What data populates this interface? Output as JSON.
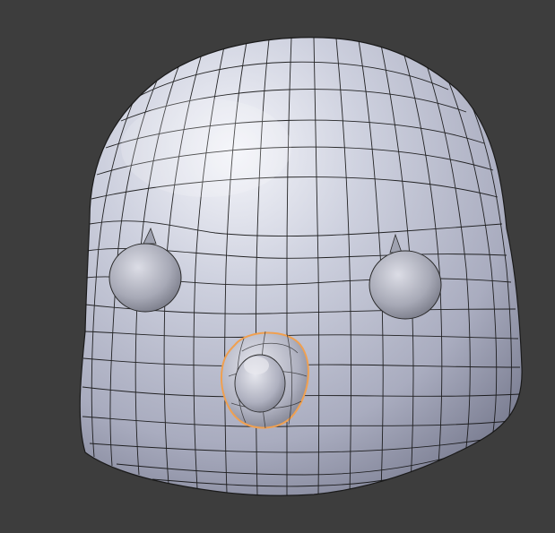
{
  "viewport": {
    "background_color": "#3d3d3d",
    "mode": "edit"
  },
  "mesh": {
    "object": "head",
    "surface_color": "#b9bccb",
    "surface_shadow_color": "#7c7f93",
    "surface_highlight_color": "#f4f5fa",
    "wireframe_color": "#101010",
    "parts": [
      "head-body",
      "left-eye",
      "right-eye",
      "nose"
    ]
  },
  "selection": {
    "selected_part": "nose",
    "outline_color": "#f0a050"
  }
}
